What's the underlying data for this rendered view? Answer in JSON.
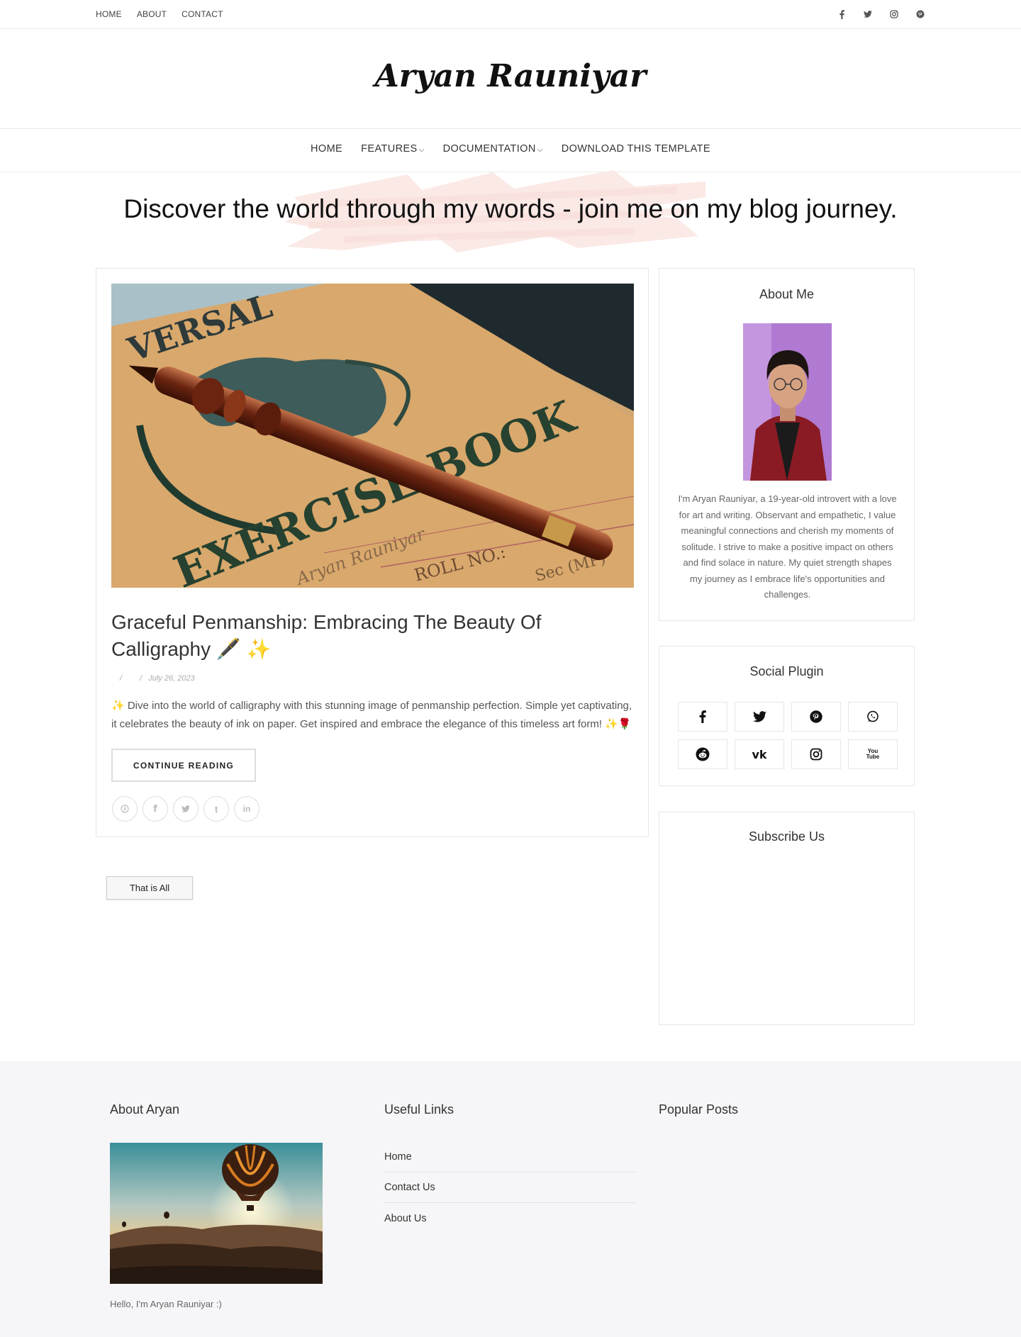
{
  "topbar": {
    "links": [
      "HOME",
      "ABOUT",
      "CONTACT"
    ],
    "social_icons": [
      "facebook-icon",
      "twitter-icon",
      "instagram-icon",
      "pinterest-icon"
    ]
  },
  "site_title": "Aryan Rauniyar",
  "main_nav": {
    "home": "HOME",
    "features": "FEATURES",
    "documentation": "DOCUMENTATION",
    "download": "DOWNLOAD THIS TEMPLATE"
  },
  "headline": "Discover the world through my words - join me on my blog journey.",
  "post": {
    "title": "Graceful Penmanship: Embracing The Beauty Of Calligraphy 🖋️ ✨",
    "meta_sep1": "/",
    "meta_sep2": "/",
    "date": "July 26, 2023",
    "excerpt": "✨ Dive into the world of calligraphy with this stunning image of penmanship perfection. Simple yet captivating, it celebrates the beauty of ink on paper. Get inspired and embrace the elegance of this timeless art form! ✨🌹",
    "continue_label": "CONTINUE READING",
    "share_icons": [
      "pinterest-icon",
      "facebook-icon",
      "twitter-icon",
      "tumblr-icon",
      "linkedin-icon"
    ],
    "image_text": {
      "top": "VERSAL",
      "book": "EXERCISE BOOK",
      "name": "Aryan Rauniyar",
      "roll": "ROLL NO.:",
      "sec": "Sec (MP)"
    }
  },
  "that_is_all": "That is All",
  "sidebar": {
    "about_title": "About Me",
    "about_text": "I'm Aryan Rauniyar, a 19-year-old introvert with a love for art and writing. Observant and empathetic, I value meaningful connections and cherish my moments of solitude. I strive to make a positive impact on others and find solace in nature. My quiet strength shapes my journey as I embrace life's opportunities and challenges.",
    "social_title": "Social Plugin",
    "social_buttons": [
      "facebook-icon",
      "twitter-icon",
      "pinterest-icon",
      "whatsapp-icon",
      "reddit-icon",
      "vk-icon",
      "instagram-icon",
      "youtube-icon"
    ],
    "youtube_label": "You Tube",
    "subscribe_title": "Subscribe Us"
  },
  "footer": {
    "col1_title": "About Aryan",
    "hello": "Hello, I'm Aryan Rauniyar :)",
    "col2_title": "Useful Links",
    "links": [
      "Home",
      "Contact Us",
      "About Us"
    ],
    "col3_title": "Popular Posts"
  },
  "colors": {
    "brush": "#fbe9e6",
    "footer_bg": "#f6f6f8",
    "border": "#e6e6e6"
  }
}
